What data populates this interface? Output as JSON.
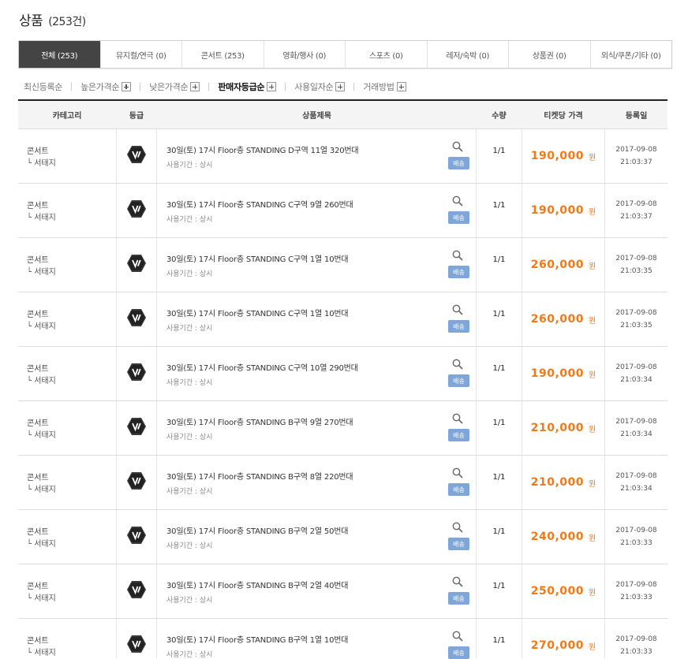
{
  "header": {
    "title": "상품",
    "count": "(253건)"
  },
  "tabs": [
    {
      "label": "전체 (253)",
      "active": true
    },
    {
      "label": "뮤지컬/연극 (0)"
    },
    {
      "label": "콘서트 (253)"
    },
    {
      "label": "영화/행사 (0)"
    },
    {
      "label": "스포츠 (0)"
    },
    {
      "label": "레저/숙박 (0)"
    },
    {
      "label": "상품권 (0)"
    },
    {
      "label": "외식/쿠폰/기타 (0)"
    }
  ],
  "sorts": [
    {
      "label": "최신등록순",
      "plus": false
    },
    {
      "label": "높은가격순",
      "plus": true
    },
    {
      "label": "낮은가격순",
      "plus": true
    },
    {
      "label": "판매자등급순",
      "plus": true,
      "active": true
    },
    {
      "label": "사용일자순",
      "plus": true
    },
    {
      "label": "거래방법",
      "plus": true
    }
  ],
  "table": {
    "headers": {
      "category": "카테고리",
      "grade": "등급",
      "title": "상품제목",
      "qty": "수량",
      "price": "티켓당 가격",
      "date": "등록일"
    },
    "rows": [
      {
        "cat": "콘서트",
        "sub": "└ 서태지",
        "title": "30일(토) 17시 Floor층 STANDING D구역 11열 320번대",
        "period": "사용기간 : 상시",
        "ship": "배송",
        "qty": "1/1",
        "price": "190,000",
        "won": "원",
        "date": "2017-09-08",
        "time": "21:03:37"
      },
      {
        "cat": "콘서트",
        "sub": "└ 서태지",
        "title": "30일(토) 17시 Floor층 STANDING C구역 9열 260번대",
        "period": "사용기간 : 상시",
        "ship": "배송",
        "qty": "1/1",
        "price": "190,000",
        "won": "원",
        "date": "2017-09-08",
        "time": "21:03:37"
      },
      {
        "cat": "콘서트",
        "sub": "└ 서태지",
        "title": "30일(토) 17시 Floor층 STANDING C구역 1열 10번대",
        "period": "사용기간 : 상시",
        "ship": "배송",
        "qty": "1/1",
        "price": "260,000",
        "won": "원",
        "date": "2017-09-08",
        "time": "21:03:35"
      },
      {
        "cat": "콘서트",
        "sub": "└ 서태지",
        "title": "30일(토) 17시 Floor층 STANDING C구역 1열 10번대",
        "period": "사용기간 : 상시",
        "ship": "배송",
        "qty": "1/1",
        "price": "260,000",
        "won": "원",
        "date": "2017-09-08",
        "time": "21:03:35"
      },
      {
        "cat": "콘서트",
        "sub": "└ 서태지",
        "title": "30일(토) 17시 Floor층 STANDING C구역 10열 290번대",
        "period": "사용기간 : 상시",
        "ship": "배송",
        "qty": "1/1",
        "price": "190,000",
        "won": "원",
        "date": "2017-09-08",
        "time": "21:03:34"
      },
      {
        "cat": "콘서트",
        "sub": "└ 서태지",
        "title": "30일(토) 17시 Floor층 STANDING B구역 9열 270번대",
        "period": "사용기간 : 상시",
        "ship": "배송",
        "qty": "1/1",
        "price": "210,000",
        "won": "원",
        "date": "2017-09-08",
        "time": "21:03:34"
      },
      {
        "cat": "콘서트",
        "sub": "└ 서태지",
        "title": "30일(토) 17시 Floor층 STANDING B구역 8열 220번대",
        "period": "사용기간 : 상시",
        "ship": "배송",
        "qty": "1/1",
        "price": "210,000",
        "won": "원",
        "date": "2017-09-08",
        "time": "21:03:34"
      },
      {
        "cat": "콘서트",
        "sub": "└ 서태지",
        "title": "30일(토) 17시 Floor층 STANDING B구역 2열 50번대",
        "period": "사용기간 : 상시",
        "ship": "배송",
        "qty": "1/1",
        "price": "240,000",
        "won": "원",
        "date": "2017-09-08",
        "time": "21:03:33"
      },
      {
        "cat": "콘서트",
        "sub": "└ 서태지",
        "title": "30일(토) 17시 Floor층 STANDING B구역 2열 40번대",
        "period": "사용기간 : 상시",
        "ship": "배송",
        "qty": "1/1",
        "price": "250,000",
        "won": "원",
        "date": "2017-09-08",
        "time": "21:03:33"
      },
      {
        "cat": "콘서트",
        "sub": "└ 서태지",
        "title": "30일(토) 17시 Floor층 STANDING B구역 1열 10번대",
        "period": "사용기간 : 상시",
        "ship": "배송",
        "qty": "1/1",
        "price": "270,000",
        "won": "원",
        "date": "2017-09-08",
        "time": "21:03:33"
      }
    ]
  },
  "icons": {
    "grade": "vip-badge-icon",
    "search": "magnifier-icon"
  },
  "colors": {
    "price": "#f07a1a",
    "ship": "#7ea6d8",
    "active_tab": "#444444"
  }
}
